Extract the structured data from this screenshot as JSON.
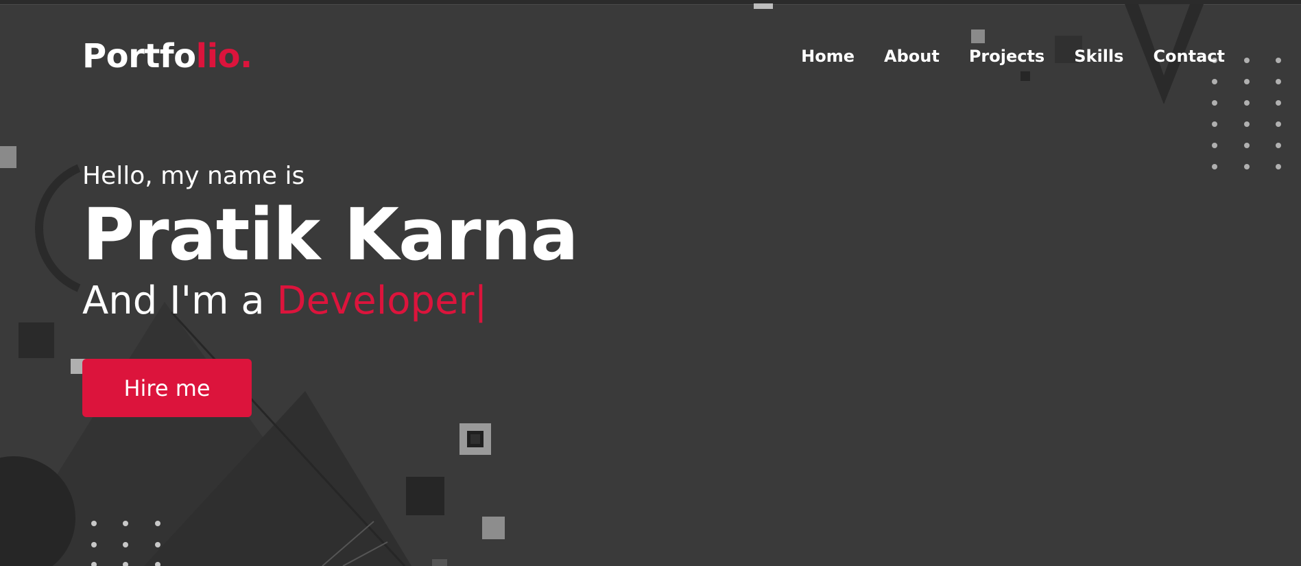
{
  "brand": {
    "text": "Portfo",
    "accent": "lio."
  },
  "nav": {
    "items": [
      {
        "label": "Home"
      },
      {
        "label": "About"
      },
      {
        "label": "Projects"
      },
      {
        "label": "Skills"
      },
      {
        "label": "Contact"
      }
    ]
  },
  "hero": {
    "greeting": "Hello, my name is",
    "name": "Pratik Karna",
    "role_prefix": "And I'm a ",
    "role_typed": "Developer|",
    "cta": "Hire me"
  },
  "colors": {
    "accent": "#dc143c",
    "background": "#3a3a3a",
    "text": "#ffffff"
  }
}
